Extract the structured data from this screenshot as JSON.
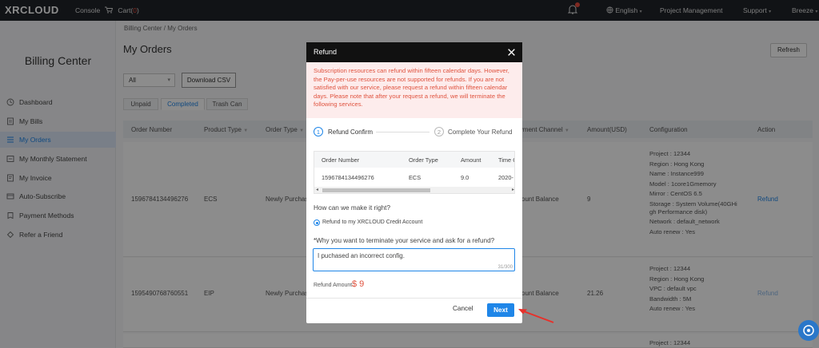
{
  "topbar": {
    "logo": "XRCLOUD",
    "console": "Console",
    "cart": "Cart(",
    "cart_count": "0",
    "cart_close": ")",
    "language": "English",
    "project_management": "Project Management",
    "support": "Support",
    "user": "Breeze"
  },
  "sidebar": {
    "title": "Billing Center",
    "items": [
      {
        "label": "Dashboard",
        "icon": "clock-icon"
      },
      {
        "label": "My Bills",
        "icon": "bill-icon"
      },
      {
        "label": "My Orders",
        "icon": "orders-icon",
        "active": true
      },
      {
        "label": "My Monthly Statement",
        "icon": "statement-icon"
      },
      {
        "label": "My Invoice",
        "icon": "invoice-icon"
      },
      {
        "label": "Auto-Subscribe",
        "icon": "subscribe-icon"
      },
      {
        "label": "Payment Methods",
        "icon": "payment-icon"
      },
      {
        "label": "Refer a Friend",
        "icon": "gift-icon"
      }
    ]
  },
  "main": {
    "breadcrumb": "Billing Center / My Orders",
    "title": "My Orders",
    "refresh": "Refresh",
    "filter_value": "All",
    "download": "Download CSV",
    "tabs": [
      "Unpaid",
      "Completed",
      "Trash Can"
    ],
    "columns": [
      "Order Number",
      "Product Type",
      "Order Type",
      "Payment Channel",
      "Amount(USD)",
      "Configuration",
      "Action"
    ],
    "rows": [
      {
        "order_number": "1596784134496276",
        "product_type": "ECS",
        "order_type": "Newly Purchas",
        "payment_channel": "count Balance",
        "amount": "9",
        "config": [
          "Project : 12344",
          "Region : Hong Kong",
          "Name : Instance999",
          "Model : 1core1Gmemory",
          "Mirror : CentOS 6.5",
          "Storage : System Volume(40GHi",
          "gh Performance disk)",
          "Network : default_network",
          "Auto renew : Yes"
        ],
        "action": "Refund"
      },
      {
        "order_number": "1595490768760551",
        "product_type": "EIP",
        "order_type": "Newly Purchas",
        "payment_channel": "count Balance",
        "amount": "21.26",
        "config": [
          "Project : 12344",
          "Region : Hong Kong",
          "VPC : default vpc",
          "Bandwidth : 5M",
          "Auto renew : Yes"
        ],
        "action": "Refund"
      },
      {
        "config": [
          "Project : 12344"
        ]
      }
    ]
  },
  "modal": {
    "title": "Refund",
    "notice": "Subscription resources can refund within fifteen calendar days. However, the Pay-per-use resources are not supported for refunds. If you are not satisfied with our service, please request a refund within fifteen calendar days. Please note that after your request a refund, we will terminate the following services.",
    "step1_num": "1",
    "step1_label": "Refund Confirm",
    "step2_num": "2",
    "step2_label": "Complete Your Refund",
    "table_headers": [
      "Order Number",
      "Order Type",
      "Amount",
      "Time C"
    ],
    "table_row": [
      "1596784134496276",
      "ECS",
      "9.0",
      "2020-"
    ],
    "question": "How can we make it right?",
    "radio_label": "Refund to my XRCLOUD Credit Account",
    "reason_label": "*Why you want to terminate your service and ask for a refund?",
    "reason_value": "I puchased an incorrect config.",
    "reason_counter": "31/300",
    "amount_label": "Refund Amount:",
    "amount_value": "$ 9",
    "cancel": "Cancel",
    "next": "Next"
  },
  "colors": {
    "accent": "#1f86e8",
    "topbar": "#1f2329",
    "warning_text": "#e0533f",
    "warning_bg": "#fdecec"
  }
}
